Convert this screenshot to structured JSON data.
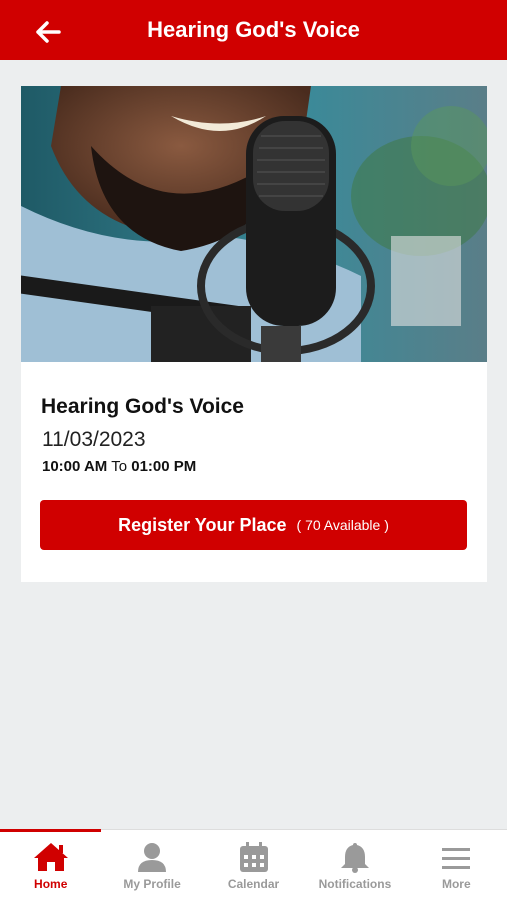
{
  "header": {
    "title": "Hearing God's Voice",
    "back_icon": "arrow-left-icon"
  },
  "event": {
    "image_alt": "Man speaking into a podcast microphone",
    "title": "Hearing God's Voice",
    "date": "11/03/2023",
    "start_time": "10:00 AM",
    "time_separator": "To",
    "end_time": "01:00 PM",
    "register_label": "Register Your Place",
    "available_text": "( 70 Available )"
  },
  "tabbar": {
    "items": [
      {
        "label": "Home",
        "icon": "home-icon",
        "active": true
      },
      {
        "label": "My Profile",
        "icon": "user-icon",
        "active": false
      },
      {
        "label": "Calendar",
        "icon": "calendar-icon",
        "active": false
      },
      {
        "label": "Notifications",
        "icon": "bell-icon",
        "active": false
      },
      {
        "label": "More",
        "icon": "menu-icon",
        "active": false
      }
    ]
  },
  "colors": {
    "brand": "#d00000",
    "inactive": "#9a9a9a",
    "background": "#eceeef"
  }
}
